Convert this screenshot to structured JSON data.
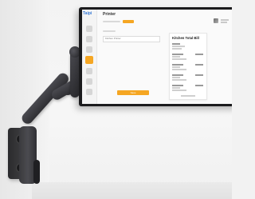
{
  "screen": {
    "brand": "Taipi",
    "page_title": "Printer",
    "select_value": "Kitchen Printer",
    "save_label": "Save",
    "receipt_title": "Kitchen Total Bill"
  },
  "colors": {
    "accent": "#f5a623",
    "brand": "#3a7bd5",
    "mount": "#2f2f33"
  }
}
